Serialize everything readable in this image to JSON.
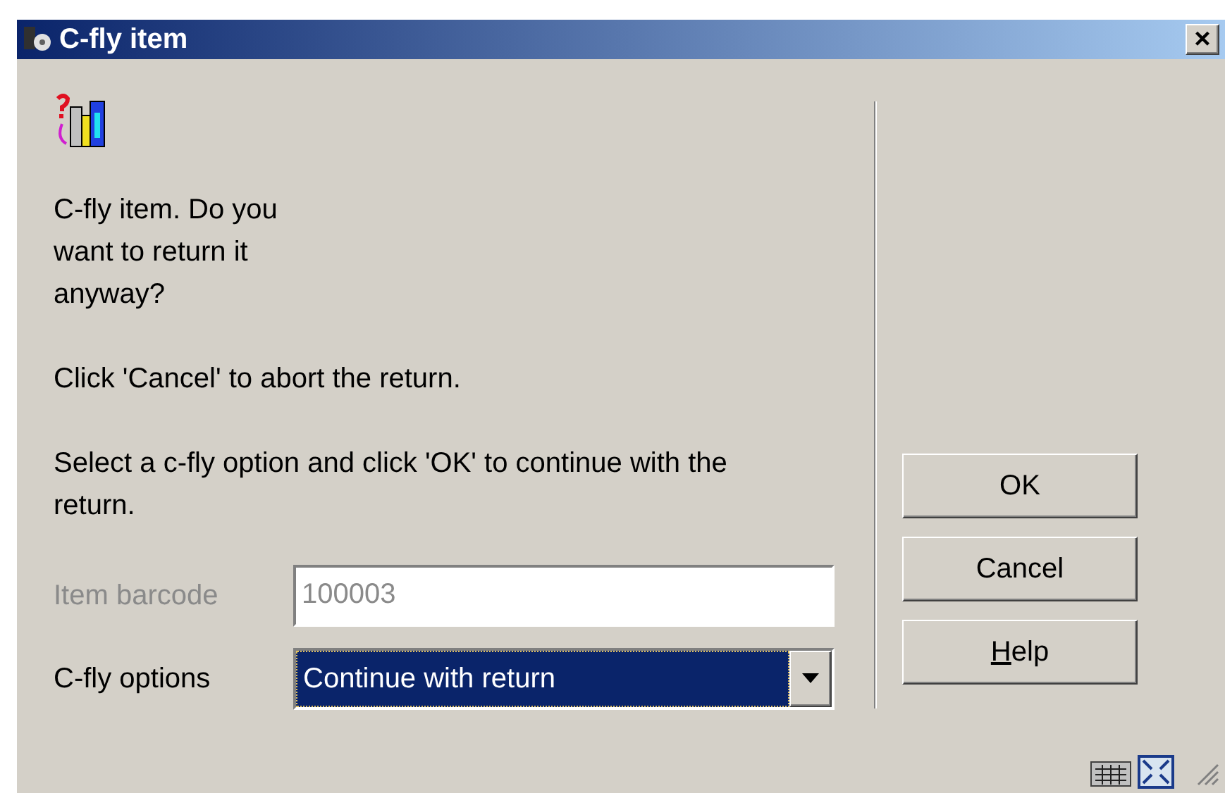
{
  "window": {
    "title": "C-fly item",
    "close": "×"
  },
  "message": [
    "C-fly item. Do you want to return it anyway?",
    "Click 'Cancel' to abort the return.",
    "Select a c-fly option and click 'OK' to continue with the return."
  ],
  "fields": [
    {
      "kind": "input",
      "label": "Item barcode",
      "value": "100003",
      "disabled": true
    },
    {
      "kind": "select",
      "label": "C-fly options",
      "value": "Continue with return",
      "disabled": false
    }
  ],
  "buttons": [
    {
      "label": "OK",
      "underline_first": false
    },
    {
      "label": "Cancel",
      "underline_first": false
    },
    {
      "label": "Help",
      "underline_first": true
    }
  ]
}
